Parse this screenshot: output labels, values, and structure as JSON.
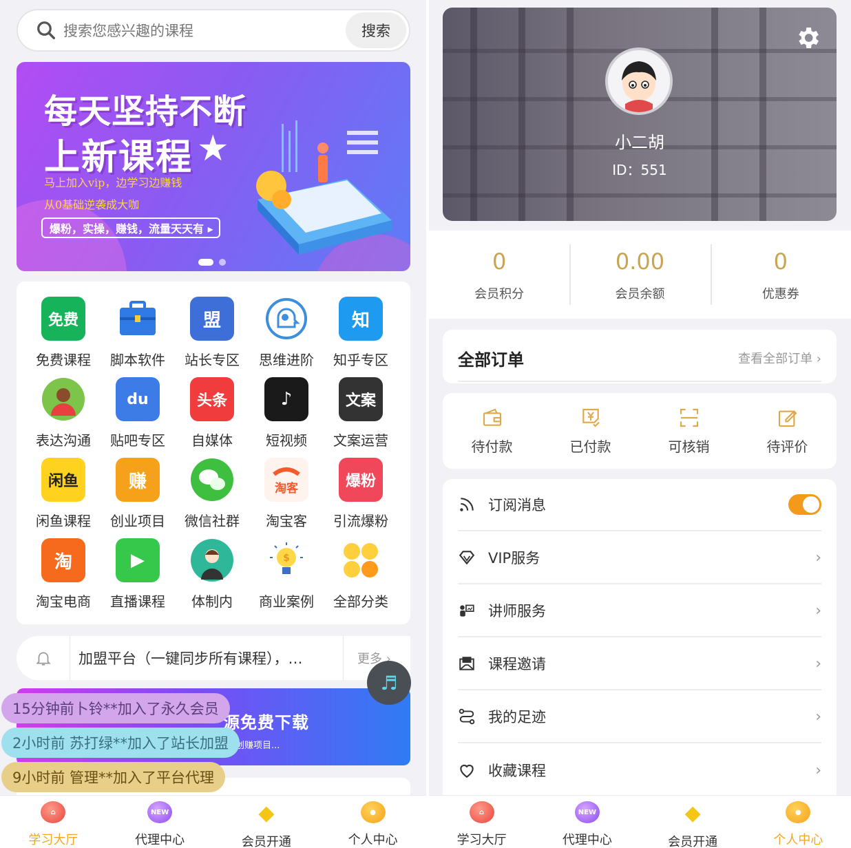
{
  "left": {
    "search": {
      "placeholder": "搜索您感兴趣的课程",
      "button": "搜索"
    },
    "banner": {
      "line1": "每天坚持不断",
      "line2": "上新课程",
      "sub1": "马上加入vip，边学习边赚钱",
      "sub2": "从0基础逆袭成大咖",
      "pill": "爆粉，实操，赚钱，流量天天有 ▸"
    },
    "categories": [
      {
        "label": "免费课程",
        "icon_text": "免费",
        "color": "#17b35a"
      },
      {
        "label": "脚本软件",
        "icon_text": "",
        "color": "#2f7ae5"
      },
      {
        "label": "站长专区",
        "icon_text": "盟",
        "color": "#3e6fd8"
      },
      {
        "label": "思维进阶",
        "icon_text": "",
        "color": "#3d8fdc"
      },
      {
        "label": "知乎专区",
        "icon_text": "知",
        "color": "#1e9bf0"
      },
      {
        "label": "表达沟通",
        "icon_text": "",
        "color": "#7cc44a"
      },
      {
        "label": "贴吧专区",
        "icon_text": "du",
        "color": "#3d7be6"
      },
      {
        "label": "自媒体",
        "icon_text": "头条",
        "color": "#f03c3c"
      },
      {
        "label": "短视频",
        "icon_text": "♪",
        "color": "#1a1a1a"
      },
      {
        "label": "文案运营",
        "icon_text": "文案",
        "color": "#333333"
      },
      {
        "label": "闲鱼课程",
        "icon_text": "闲鱼",
        "color": "#ffd21f"
      },
      {
        "label": "创业项目",
        "icon_text": "赚",
        "color": "#f5a21a"
      },
      {
        "label": "微信社群",
        "icon_text": "",
        "color": "#3fbf3f"
      },
      {
        "label": "淘宝客",
        "icon_text": "淘客",
        "color": "#ffffff"
      },
      {
        "label": "引流爆粉",
        "icon_text": "爆粉",
        "color": "#f0475b"
      },
      {
        "label": "淘宝电商",
        "icon_text": "淘",
        "color": "#f56a1c"
      },
      {
        "label": "直播课程",
        "icon_text": "▶",
        "color": "#35c84a"
      },
      {
        "label": "体制内",
        "icon_text": "",
        "color": "#2fb79a"
      },
      {
        "label": "商业案例",
        "icon_text": "",
        "color": "#ffffff"
      },
      {
        "label": "全部分类",
        "icon_text": "",
        "color": "#ffffff"
      }
    ],
    "notice": {
      "text": "加盟平台（一键同步所有课程），…",
      "more": "更多 ›"
    },
    "banner2": {
      "title": "源免费下载",
      "sub": "创赚项目..."
    },
    "toasts": [
      "15分钟前卜铃**加入了永久会员",
      "2小时前 苏打绿**加入了站长加盟",
      "9小时前 管理**加入了平台代理"
    ],
    "tabs": [
      {
        "label": "学习大厅",
        "active": true
      },
      {
        "label": "代理中心",
        "badge": "NEW"
      },
      {
        "label": "会员开通"
      },
      {
        "label": "个人中心"
      }
    ]
  },
  "right": {
    "user": {
      "name": "小二胡",
      "id": "ID：551"
    },
    "stats": [
      {
        "value": "0",
        "label": "会员积分"
      },
      {
        "value": "0.00",
        "label": "会员余额"
      },
      {
        "value": "0",
        "label": "优惠券"
      }
    ],
    "orders": {
      "title": "全部订单",
      "all": "查看全部订单 ›"
    },
    "order_states": [
      {
        "label": "待付款"
      },
      {
        "label": "已付款"
      },
      {
        "label": "可核销"
      },
      {
        "label": "待评价"
      }
    ],
    "menu": [
      {
        "label": "订阅消息",
        "toggle": true
      },
      {
        "label": "VIP服务"
      },
      {
        "label": "讲师服务"
      },
      {
        "label": "课程邀请"
      },
      {
        "label": "我的足迹"
      },
      {
        "label": "收藏课程"
      }
    ],
    "tabs": [
      {
        "label": "学习大厅"
      },
      {
        "label": "代理中心",
        "badge": "NEW"
      },
      {
        "label": "会员开通"
      },
      {
        "label": "个人中心",
        "active": true
      }
    ]
  },
  "colors": {
    "accent": "#f5a623",
    "gold": "#c8a455",
    "toggle": "#f39a1a"
  }
}
